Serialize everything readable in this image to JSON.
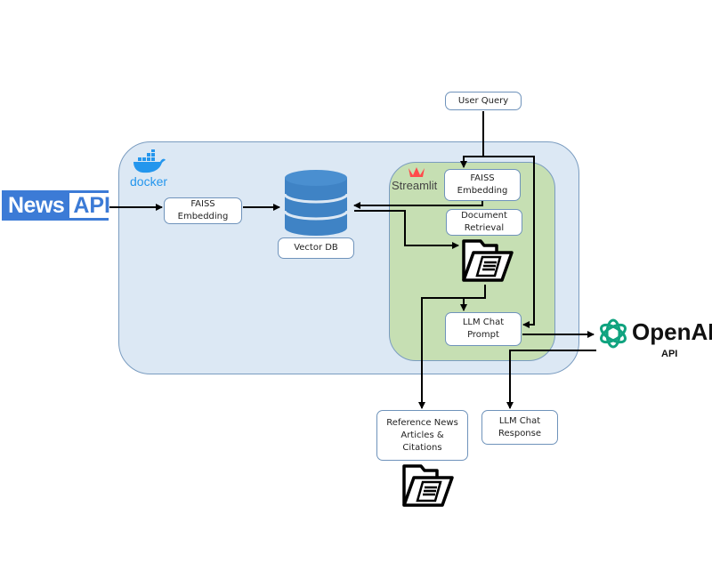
{
  "containers": {
    "docker": {
      "label": "docker",
      "fill": "#dce8f4"
    },
    "streamlit": {
      "label": "Streamlit",
      "fill": "#c6dfb3"
    }
  },
  "sources": {
    "news_api": {
      "word1": "News",
      "word2": "API",
      "color": "#3c7bd6"
    }
  },
  "nodes": {
    "faiss_embedding_ingest": "FAISS Embedding",
    "vector_db": "Vector DB",
    "user_query": "User Query",
    "faiss_embedding_query": "FAISS Embedding",
    "document_retrieval": "Document Retrieval",
    "llm_chat_prompt": "LLM Chat Prompt",
    "reference_news": "Reference News Articles & Citations",
    "llm_chat_response": "LLM Chat Response"
  },
  "openai": {
    "label": "OpenAI",
    "sublabel": "API",
    "color": "#10a37f"
  },
  "icons": [
    "docker-whale-icon",
    "streamlit-crown-icon",
    "database-icon",
    "folder-document-icon",
    "openai-logo-icon"
  ]
}
